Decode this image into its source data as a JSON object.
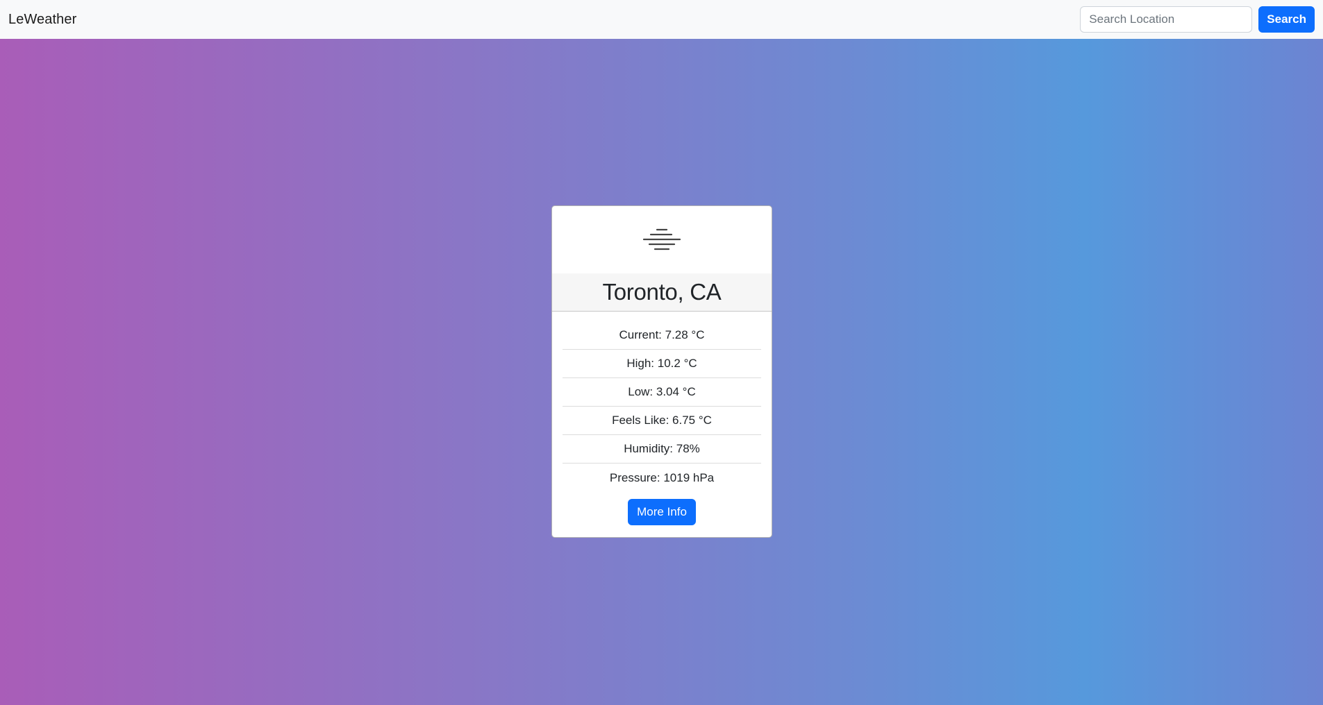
{
  "navbar": {
    "brand": "LeWeather",
    "search_placeholder": "Search Location",
    "search_value": "",
    "search_button_label": "Search"
  },
  "weather_card": {
    "icon": "mist-icon",
    "location": "Toronto, CA",
    "stats": [
      "Current: 7.28 °C",
      "High: 10.2 °C",
      "Low: 3.04 °C",
      "Feels Like: 6.75 °C",
      "Humidity: 78%",
      "Pressure: 1019 hPa"
    ],
    "more_info_label": "More Info"
  },
  "colors": {
    "primary": "#0d6efd",
    "gradient_start": "#a95db8",
    "gradient_mid": "#5699dc"
  }
}
